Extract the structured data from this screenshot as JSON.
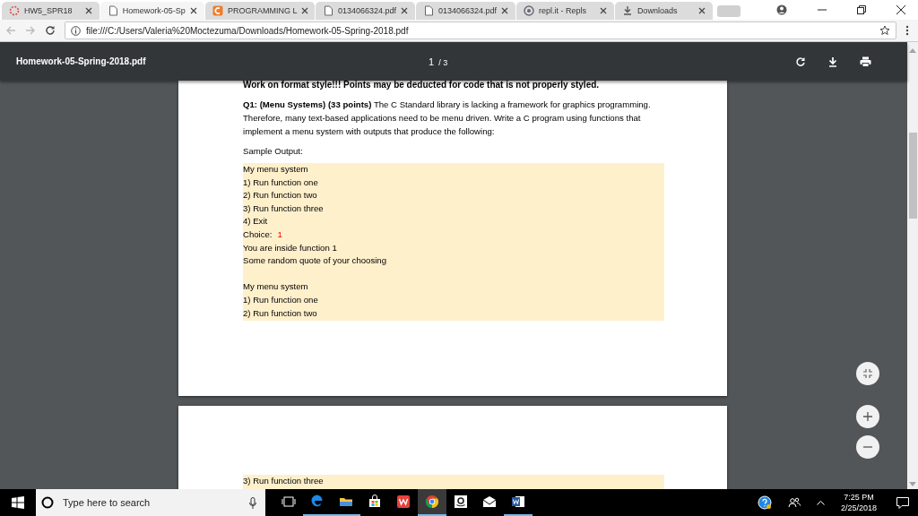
{
  "tabs": [
    {
      "title": "HW5_SPR18",
      "kind": "loading",
      "selected": false
    },
    {
      "title": "Homework-05-Sp",
      "kind": "document",
      "selected": true
    },
    {
      "title": "PROGRAMMING L",
      "kind": "code",
      "selected": false
    },
    {
      "title": "0134066324.pdf",
      "kind": "document",
      "selected": false
    },
    {
      "title": "0134066324.pdf",
      "kind": "document",
      "selected": false
    },
    {
      "title": "repl.it - Repls",
      "kind": "repl",
      "selected": false
    },
    {
      "title": "Downloads",
      "kind": "download",
      "selected": false
    }
  ],
  "address_bar": {
    "url": "file:///C:/Users/Valeria%20Moctezuma/Downloads/Homework-05-Spring-2018.pdf"
  },
  "pdf_toolbar": {
    "title": "Homework-05-Spring-2018.pdf",
    "page": "1",
    "page_total": "/ 3"
  },
  "pages": [
    {
      "notice": "Work on format style!!! Points may be deducted for code that is not properly styled.",
      "question": "**Q1: (Menu Systems) (33 points)** The C Standard library is lacking a framework for graphics programming. Therefore, many text-based applications need to be menu driven. Write a C program using functions that implement a menu system with outputs that produce the following:",
      "sample_label": "Sample Output:",
      "output": [
        {
          "kind": "line",
          "text": "My menu system"
        },
        {
          "kind": "line",
          "text": "1) Run function one"
        },
        {
          "kind": "line",
          "text": "2) Run function two"
        },
        {
          "kind": "line",
          "text": "3) Run function three"
        },
        {
          "kind": "line",
          "text": "4) Exit"
        },
        {
          "kind": "line",
          "text": "Choice:",
          "input": "1"
        },
        {
          "kind": "line",
          "text": "You are inside function 1"
        },
        {
          "kind": "line",
          "text": "Some random quote of your choosing"
        },
        {
          "kind": "blank"
        },
        {
          "kind": "line",
          "text": "My menu system"
        },
        {
          "kind": "line",
          "text": "1) Run function one"
        },
        {
          "kind": "line",
          "text": "2) Run function two"
        }
      ]
    },
    {
      "output": [
        {
          "kind": "line",
          "text": "3) Run function three"
        }
      ]
    }
  ],
  "taskbar": {
    "search_placeholder": "Type here to search",
    "apps": [
      {
        "kind": "taskview",
        "selected": false,
        "running": false
      },
      {
        "kind": "edge",
        "selected": false,
        "running": true
      },
      {
        "kind": "explorer",
        "selected": false,
        "running": true
      },
      {
        "kind": "store",
        "selected": false,
        "running": false
      },
      {
        "kind": "wps",
        "selected": false,
        "running": false
      },
      {
        "kind": "chrome",
        "selected": true,
        "running": true
      },
      {
        "kind": "amazon",
        "selected": false,
        "running": false
      },
      {
        "kind": "mail",
        "selected": false,
        "running": false
      },
      {
        "kind": "word",
        "selected": false,
        "running": true
      }
    ],
    "time": "7:25 PM",
    "date": "2/25/2018"
  }
}
